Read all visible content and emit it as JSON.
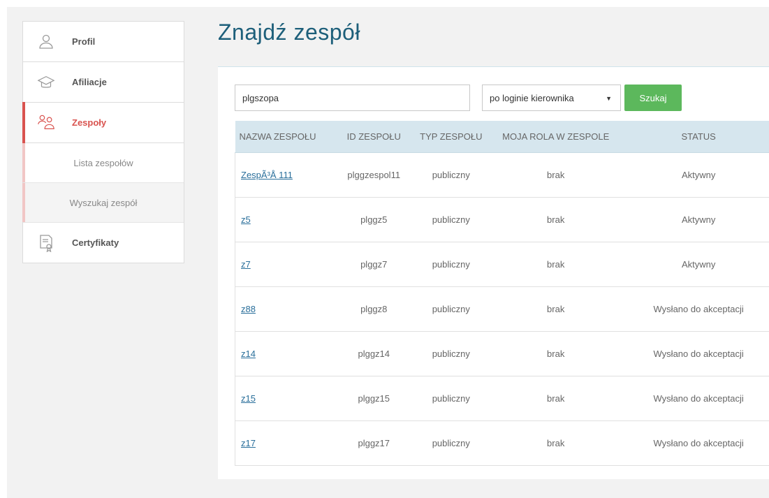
{
  "sidebar": {
    "items": [
      {
        "label": "Profil",
        "icon": "user-icon"
      },
      {
        "label": "Afiliacje",
        "icon": "graduation-cap-icon"
      },
      {
        "label": "Zespoły",
        "icon": "team-icon"
      },
      {
        "label": "Certyfikaty",
        "icon": "certificate-icon"
      }
    ],
    "subitems": [
      {
        "label": "Lista zespołów"
      },
      {
        "label": "Wyszukaj zespół"
      }
    ]
  },
  "page": {
    "title": "Znajdź zespół"
  },
  "search": {
    "value": "plgszopa",
    "mode_selected": "po loginie kierownika",
    "button_label": "Szukaj"
  },
  "table": {
    "headers": [
      "NAZWA ZESPOŁU",
      "ID ZESPOŁU",
      "TYP ZESPOŁU",
      "MOJA ROLA W ZESPOLE",
      "STATUS"
    ],
    "rows": [
      {
        "name": "ZespÃ³Å 111",
        "id": "plggzespol11",
        "type": "publiczny",
        "role": "brak",
        "status": "Aktywny"
      },
      {
        "name": "z5",
        "id": "plggz5",
        "type": "publiczny",
        "role": "brak",
        "status": "Aktywny"
      },
      {
        "name": "z7",
        "id": "plggz7",
        "type": "publiczny",
        "role": "brak",
        "status": "Aktywny"
      },
      {
        "name": "z88",
        "id": "plggz8",
        "type": "publiczny",
        "role": "brak",
        "status": "Wysłano do akceptacji"
      },
      {
        "name": "z14",
        "id": "plggz14",
        "type": "publiczny",
        "role": "brak",
        "status": "Wysłano do akceptacji"
      },
      {
        "name": "z15",
        "id": "plggz15",
        "type": "publiczny",
        "role": "brak",
        "status": "Wysłano do akceptacji"
      },
      {
        "name": "z17",
        "id": "plggz17",
        "type": "publiczny",
        "role": "brak",
        "status": "Wysłano do akceptacji"
      }
    ]
  },
  "colors": {
    "accent_red": "#d9534f",
    "title_blue": "#1d5f7a",
    "button_green": "#5cb85c",
    "header_bg": "#d6e6ee",
    "link": "#2a6f9b"
  }
}
